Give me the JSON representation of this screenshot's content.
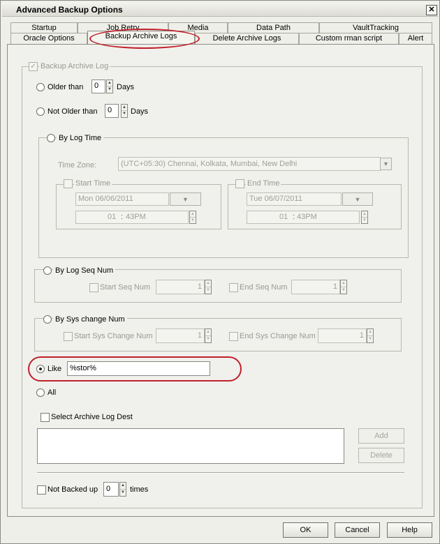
{
  "window": {
    "title": "Advanced Backup Options",
    "close": "✕"
  },
  "tabs_row1": [
    "Startup",
    "Job Retry",
    "Media",
    "Data Path",
    "VaultTracking"
  ],
  "tabs_row2": [
    "Oracle Options",
    "Backup Archive Logs",
    "Delete Archive Logs",
    "Custom rman script",
    "Alert"
  ],
  "archive": {
    "group_label": "Backup Archive Log",
    "older_than": {
      "label": "Older than",
      "value": "0",
      "unit": "Days"
    },
    "not_older_than": {
      "label": "Not Older than",
      "value": "0",
      "unit": "Days"
    },
    "by_log_time": {
      "label": "By Log Time",
      "timezone_label": "Time Zone:",
      "timezone_value": "(UTC+05:30) Chennai, Kolkata, Mumbai, New Delhi",
      "start": {
        "label": "Start Time",
        "date": "Mon 06/06/2011",
        "hour": "01",
        "minute": "43PM"
      },
      "end": {
        "label": "End Time",
        "date": "Tue 06/07/2011",
        "hour": "01",
        "minute": "43PM"
      }
    },
    "by_log_seq": {
      "label": "By Log Seq Num",
      "start_label": "Start Seq Num",
      "start_value": "1",
      "end_label": "End Seq Num",
      "end_value": "1"
    },
    "by_sys_change": {
      "label": "By Sys change Num",
      "start_label": "Start Sys Change Num",
      "start_value": "1",
      "end_label": "End Sys Change Num",
      "end_value": "1"
    },
    "like": {
      "label": "Like",
      "value": "%stor%"
    },
    "all": {
      "label": "All"
    },
    "select_dest": {
      "label": "Select Archive Log Dest",
      "add": "Add",
      "delete": "Delete"
    },
    "not_backed_up": {
      "label": "Not Backed up",
      "value": "0",
      "unit": "times"
    }
  },
  "footer": {
    "ok": "OK",
    "cancel": "Cancel",
    "help": "Help"
  },
  "colors": {
    "highlight": "#c0202a",
    "panel": "#f0f0ec"
  }
}
